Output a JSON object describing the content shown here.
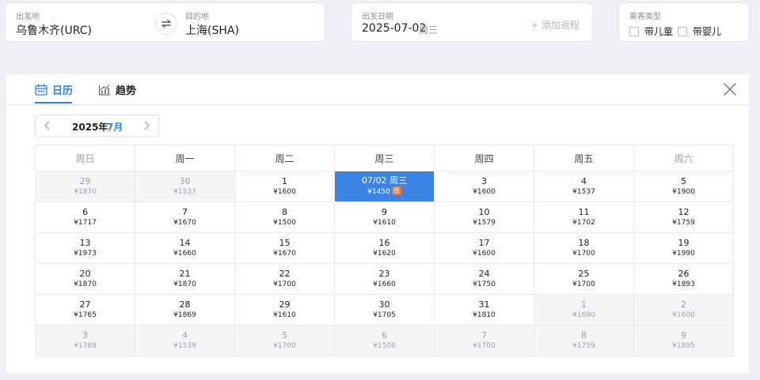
{
  "search": {
    "from": {
      "label": "出发地",
      "value": "乌鲁木齐(URC)"
    },
    "to": {
      "label": "目的地",
      "value": "上海(SHA)"
    },
    "date": {
      "label": "出发日期",
      "value": "2025-07-02",
      "weekday": "周三",
      "add_return": "+ 添加返程"
    },
    "passengers": {
      "label": "乘客类型",
      "options": [
        "带儿童",
        "带婴儿"
      ]
    }
  },
  "tabs": [
    {
      "label": "日历",
      "icon": "calendar-icon",
      "active": true
    },
    {
      "label": "趋势",
      "icon": "trend-chart-icon",
      "active": false
    }
  ],
  "month_nav": {
    "year": "2025年",
    "month": "7月"
  },
  "weekdays": [
    "周日",
    "周一",
    "周二",
    "周三",
    "周四",
    "周五",
    "周六"
  ],
  "weeks": [
    [
      {
        "day": "29",
        "price": "¥1870",
        "other": true
      },
      {
        "day": "30",
        "price": "¥1537",
        "other": true
      },
      {
        "day": "1",
        "price": "¥1600"
      },
      {
        "day": "07/02 周三",
        "price": "¥1450",
        "selected": true,
        "tag": "低"
      },
      {
        "day": "3",
        "price": "¥1600"
      },
      {
        "day": "4",
        "price": "¥1537"
      },
      {
        "day": "5",
        "price": "¥1900"
      }
    ],
    [
      {
        "day": "6",
        "price": "¥1717"
      },
      {
        "day": "7",
        "price": "¥1670"
      },
      {
        "day": "8",
        "price": "¥1500"
      },
      {
        "day": "9",
        "price": "¥1610"
      },
      {
        "day": "10",
        "price": "¥1579"
      },
      {
        "day": "11",
        "price": "¥1702"
      },
      {
        "day": "12",
        "price": "¥1759"
      }
    ],
    [
      {
        "day": "13",
        "price": "¥1973"
      },
      {
        "day": "14",
        "price": "¥1660"
      },
      {
        "day": "15",
        "price": "¥1670"
      },
      {
        "day": "16",
        "price": "¥1620"
      },
      {
        "day": "17",
        "price": "¥1600"
      },
      {
        "day": "18",
        "price": "¥1700"
      },
      {
        "day": "19",
        "price": "¥1990"
      }
    ],
    [
      {
        "day": "20",
        "price": "¥1870"
      },
      {
        "day": "21",
        "price": "¥1870"
      },
      {
        "day": "22",
        "price": "¥1700"
      },
      {
        "day": "23",
        "price": "¥1660"
      },
      {
        "day": "24",
        "price": "¥1750"
      },
      {
        "day": "25",
        "price": "¥1700"
      },
      {
        "day": "26",
        "price": "¥1893"
      }
    ],
    [
      {
        "day": "27",
        "price": "¥1765"
      },
      {
        "day": "28",
        "price": "¥1869"
      },
      {
        "day": "29",
        "price": "¥1610"
      },
      {
        "day": "30",
        "price": "¥1705"
      },
      {
        "day": "31",
        "price": "¥1810"
      },
      {
        "day": "1",
        "price": "¥1690",
        "other": true
      },
      {
        "day": "2",
        "price": "¥1600",
        "other": true
      }
    ],
    [
      {
        "day": "3",
        "price": "¥1788",
        "other": true
      },
      {
        "day": "4",
        "price": "¥1539",
        "other": true
      },
      {
        "day": "5",
        "price": "¥1700",
        "other": true
      },
      {
        "day": "6",
        "price": "¥1500",
        "other": true
      },
      {
        "day": "7",
        "price": "¥1700",
        "other": true
      },
      {
        "day": "8",
        "price": "¥1759",
        "other": true
      },
      {
        "day": "9",
        "price": "¥1895",
        "other": true
      }
    ]
  ],
  "colors": {
    "accent": "#2a82e4",
    "selected_bg": "#3b84e6",
    "low_tag": "#f0743a"
  }
}
